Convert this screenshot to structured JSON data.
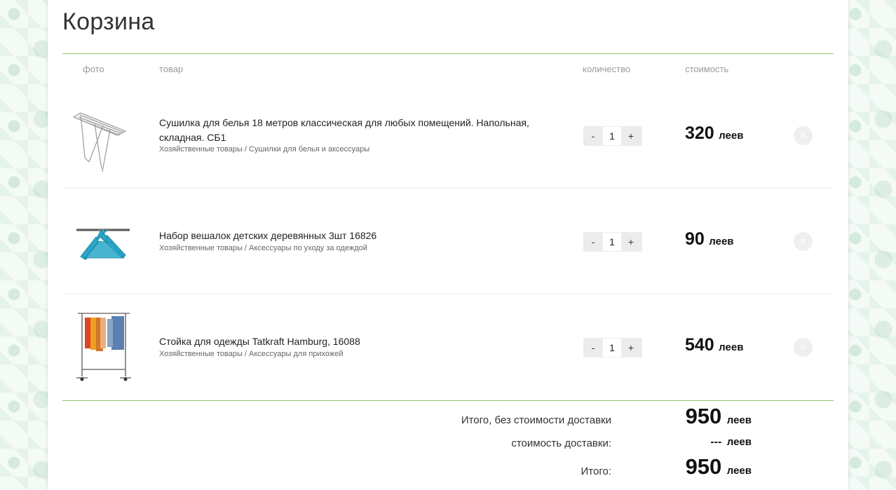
{
  "title": "Корзина",
  "columns": {
    "photo": "фото",
    "product": "товар",
    "quantity": "количество",
    "cost": "стоимость"
  },
  "items": [
    {
      "name": "Сушилка для белья 18 метров классическая для любых помещений. Напольная, складная. СБ1",
      "category": "Хозяйственные товары / Сушилки для белья и аксессуары",
      "quantity": "1",
      "price": "320",
      "currency": "леев",
      "image": "clothes-drying-rack"
    },
    {
      "name": "Набор вешалок детских деревянных 3шт 16826",
      "category": "Хозяйственные товары / Аксессуары по уходу за одеждой",
      "quantity": "1",
      "price": "90",
      "currency": "леев",
      "image": "blue-hangers"
    },
    {
      "name": "Стойка для одежды Tatkraft Hamburg, 16088",
      "category": "Хозяйственные товары / Аксессуары для прихожей",
      "quantity": "1",
      "price": "540",
      "currency": "леев",
      "image": "clothes-rack"
    }
  ],
  "controls": {
    "minus": "-",
    "plus": "+",
    "remove": "×"
  },
  "summary": {
    "subtotal_label": "Итого, без стоимости доставки",
    "subtotal_value": "950",
    "delivery_label": "стоимость доставки:",
    "delivery_value": "---",
    "total_label": "Итого:",
    "total_value": "950",
    "currency": "леев"
  },
  "colors": {
    "accent_line": "#8cc56a",
    "hanger_blue": "#2aa7c9"
  }
}
